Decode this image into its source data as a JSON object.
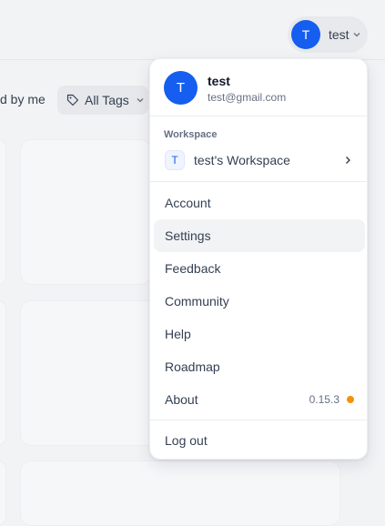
{
  "header": {
    "user_initial": "T",
    "user_name": "test"
  },
  "filters": {
    "created_by_me_partial": "d by me",
    "tags_label": "All Tags"
  },
  "dropdown": {
    "profile": {
      "initial": "T",
      "name": "test",
      "email": "test@gmail.com"
    },
    "workspace": {
      "heading": "Workspace",
      "initial": "T",
      "name": "test's Workspace"
    },
    "menu": {
      "account": "Account",
      "settings": "Settings",
      "feedback": "Feedback",
      "community": "Community",
      "help": "Help",
      "roadmap": "Roadmap",
      "about": "About",
      "version": "0.15.3",
      "logout": "Log out"
    }
  },
  "colors": {
    "accent": "#155eef",
    "update_dot": "#f79009",
    "active_item_bg": "#f2f3f5"
  }
}
